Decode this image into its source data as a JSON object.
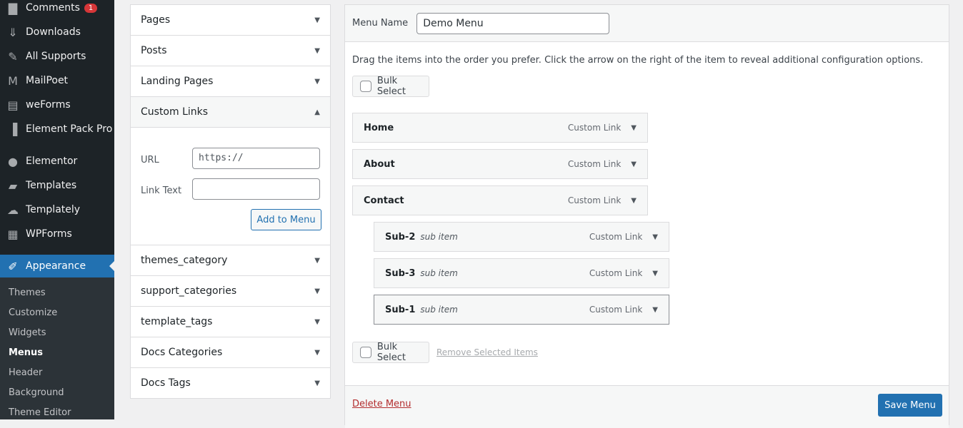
{
  "sidebar": {
    "items": [
      {
        "label": "Comments",
        "icon": "comment-icon",
        "glyph": "▇",
        "badge": "1"
      },
      {
        "label": "Downloads",
        "icon": "download-icon",
        "glyph": "⇓"
      },
      {
        "label": "All Supports",
        "icon": "pin-icon",
        "glyph": "✎"
      },
      {
        "label": "MailPoet",
        "icon": "mailpoet-icon",
        "glyph": "M"
      },
      {
        "label": "weForms",
        "icon": "weforms-icon",
        "glyph": "▤"
      },
      {
        "label": "Element Pack Pro",
        "icon": "element-pack-icon",
        "glyph": "▐"
      },
      {
        "label": "Elementor",
        "icon": "elementor-icon",
        "glyph": "●"
      },
      {
        "label": "Templates",
        "icon": "folder-icon",
        "glyph": "▰"
      },
      {
        "label": "Templately",
        "icon": "templately-icon",
        "glyph": "☁"
      },
      {
        "label": "WPForms",
        "icon": "wpforms-icon",
        "glyph": "▦"
      }
    ],
    "active": {
      "label": "Appearance",
      "icon": "paintbrush-icon",
      "glyph": "✐"
    },
    "submenu": [
      "Themes",
      "Customize",
      "Widgets",
      "Menus",
      "Header",
      "Background",
      "Theme Editor"
    ],
    "current_submenu": "Menus"
  },
  "accordion": {
    "top": [
      "Pages",
      "Posts",
      "Landing Pages"
    ],
    "open": "Custom Links",
    "bottom": [
      "themes_category",
      "support_categories",
      "template_tags",
      "Docs Categories",
      "Docs Tags"
    ],
    "custom_links": {
      "url_label": "URL",
      "url_value": "https://",
      "link_text_label": "Link Text",
      "link_text_value": "",
      "add_button": "Add to Menu"
    }
  },
  "menu": {
    "name_label": "Menu Name",
    "name_value": "Demo Menu",
    "description": "Drag the items into the order you prefer. Click the arrow on the right of the item to reveal additional configuration options.",
    "bulk_select": "Bulk Select",
    "remove_selected": "Remove Selected Items",
    "items": [
      {
        "title": "Home",
        "sub": "",
        "type": "Custom Link",
        "depth": 0
      },
      {
        "title": "About",
        "sub": "",
        "type": "Custom Link",
        "depth": 0
      },
      {
        "title": "Contact",
        "sub": "",
        "type": "Custom Link",
        "depth": 0
      },
      {
        "title": "Sub-2",
        "sub": "sub item",
        "type": "Custom Link",
        "depth": 1
      },
      {
        "title": "Sub-3",
        "sub": "sub item",
        "type": "Custom Link",
        "depth": 1
      },
      {
        "title": "Sub-1",
        "sub": "sub item",
        "type": "Custom Link",
        "depth": 1
      }
    ],
    "delete": "Delete Menu",
    "save": "Save Menu"
  },
  "colors": {
    "sidebar": "#1d2327",
    "accent": "#2271b1",
    "danger": "#b32d2e"
  }
}
